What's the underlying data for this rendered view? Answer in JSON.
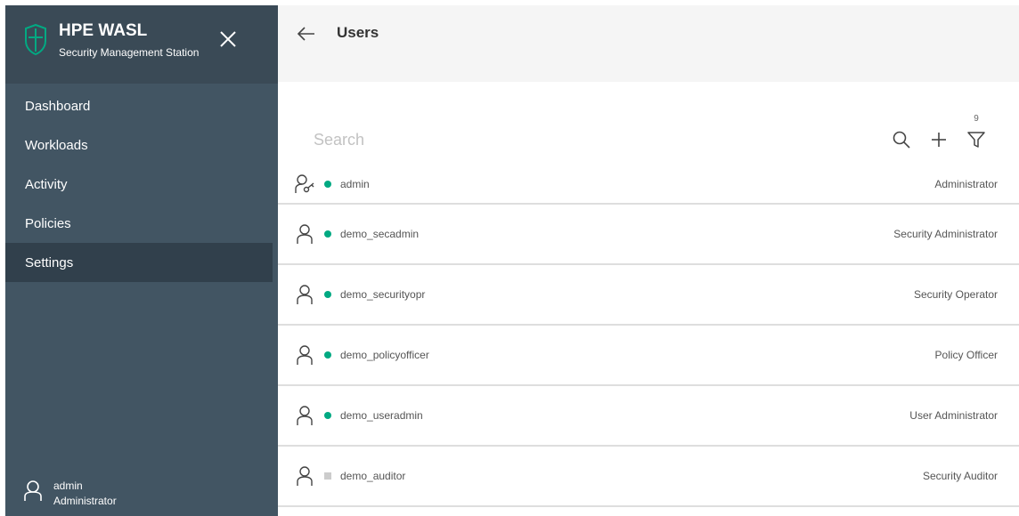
{
  "sidebar": {
    "app_name": "HPE WASL",
    "app_subtitle": "Security Management Station",
    "nav": [
      {
        "label": "Dashboard",
        "active": false
      },
      {
        "label": "Workloads",
        "active": false
      },
      {
        "label": "Activity",
        "active": false
      },
      {
        "label": "Policies",
        "active": false
      },
      {
        "label": "Settings",
        "active": true
      }
    ],
    "footer": {
      "user_name": "admin",
      "user_role": "Administrator"
    }
  },
  "header": {
    "title": "Users"
  },
  "toolbar": {
    "search_placeholder": "Search",
    "filter_count": "9"
  },
  "users": [
    {
      "name": "admin",
      "role": "Administrator",
      "status": "active",
      "icon": "user-admin-icon"
    },
    {
      "name": "demo_secadmin",
      "role": "Security Administrator",
      "status": "active",
      "icon": "user-icon"
    },
    {
      "name": "demo_securityopr",
      "role": "Security Operator",
      "status": "active",
      "icon": "user-icon"
    },
    {
      "name": "demo_policyofficer",
      "role": "Policy Officer",
      "status": "active",
      "icon": "user-icon"
    },
    {
      "name": "demo_useradmin",
      "role": "User Administrator",
      "status": "active",
      "icon": "user-icon"
    },
    {
      "name": "demo_auditor",
      "role": "Security Auditor",
      "status": "inactive",
      "icon": "user-icon"
    }
  ],
  "colors": {
    "sidebar_bg": "#425563",
    "active_nav_bg": "#31404c",
    "status_active": "#01a982",
    "status_inactive": "#cccccc",
    "header_bg": "#f5f5f5"
  }
}
